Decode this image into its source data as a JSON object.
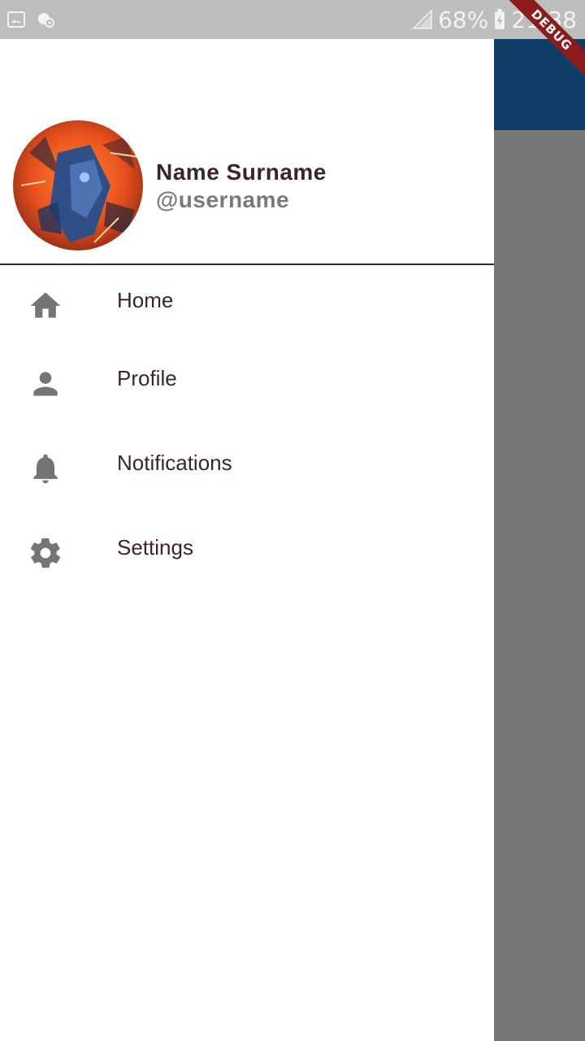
{
  "status_bar": {
    "battery": "68%",
    "time": "21:38",
    "debug_label": "DEBUG"
  },
  "drawer": {
    "user": {
      "name": "Name Surname",
      "username": "@username"
    },
    "items": [
      {
        "label": "Home",
        "icon": "home-icon"
      },
      {
        "label": "Profile",
        "icon": "person-icon"
      },
      {
        "label": "Notifications",
        "icon": "bell-icon"
      },
      {
        "label": "Settings",
        "icon": "gear-icon"
      }
    ]
  },
  "colors": {
    "app_bar": "#0f3f68",
    "scrim": "#757575",
    "text_primary": "#3b2330",
    "icon_grey": "#757575"
  }
}
